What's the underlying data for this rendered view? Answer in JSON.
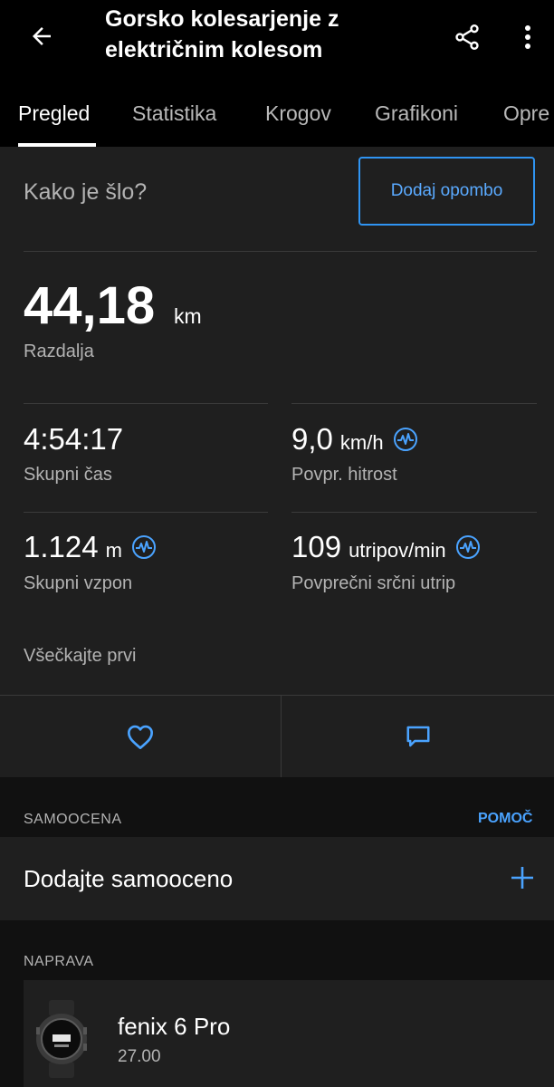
{
  "header": {
    "title": "Gorsko kolesarjenje z električnim kolesom",
    "back_icon": "arrow-left-icon",
    "share_icon": "share-icon",
    "more_icon": "more-vertical-icon"
  },
  "tabs": [
    {
      "label": "Pregled",
      "active": true
    },
    {
      "label": "Statistika",
      "active": false
    },
    {
      "label": "Krogov",
      "active": false
    },
    {
      "label": "Grafikoni",
      "active": false
    },
    {
      "label": "Opre",
      "active": false
    }
  ],
  "summary": {
    "prompt": "Kako je šlo?",
    "note_button": "Dodaj opombo",
    "distance": {
      "value": "44,18",
      "unit": "km",
      "label": "Razdalja"
    },
    "stats": [
      {
        "value": "4:54:17",
        "unit": "",
        "label": "Skupni čas",
        "has_chart_icon": false
      },
      {
        "value": "9,0",
        "unit": "km/h",
        "label": "Povpr. hitrost",
        "has_chart_icon": true
      },
      {
        "value": "1.124",
        "unit": "m",
        "label": "Skupni vzpon",
        "has_chart_icon": true
      },
      {
        "value": "109",
        "unit": "utripov/min",
        "label": "Povprečni srčni utrip",
        "has_chart_icon": true
      }
    ],
    "like_text": "Všečkajte prvi",
    "like_icon": "heart-icon",
    "comment_icon": "comment-icon"
  },
  "self_eval": {
    "section_label": "SAMOOCENA",
    "help_label": "POMOČ",
    "add_label": "Dodajte samooceno",
    "add_icon": "plus-icon"
  },
  "device": {
    "section_label": "NAPRAVA",
    "name": "fenix 6 Pro",
    "version": "27.00"
  },
  "colors": {
    "accent": "#2f94f2",
    "background": "#111111",
    "card": "#1f1f1f",
    "header": "#000000"
  }
}
